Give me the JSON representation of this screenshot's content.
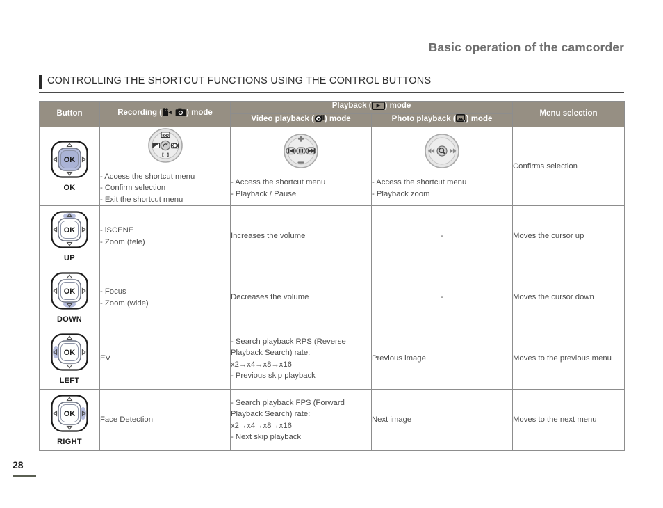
{
  "running_head": "Basic operation of the camcorder",
  "section_title": "CONTROLLING THE SHORTCUT FUNCTIONS USING THE CONTROL BUTTONS",
  "page_number": "28",
  "table": {
    "headers": {
      "button": "Button",
      "recording_pre": "Recording (",
      "recording_post": ") mode",
      "playback_pre": "Playback (",
      "playback_post": ") mode",
      "video_playback_pre": "Video playback (",
      "video_playback_post": ") mode",
      "photo_playback_pre": "Photo playback (",
      "photo_playback_post": ") mode",
      "menu_selection": "Menu selection"
    },
    "icons": {
      "recording_movie": "movie-camera-icon",
      "recording_photo": "still-camera-icon",
      "playback": "play-mode-icon",
      "video_playback": "video-playback-icon",
      "photo_playback": "photo-playback-icon"
    },
    "rows": [
      {
        "button_label": "OK",
        "dial": "ok-center",
        "recording": "- Access the shortcut menu\n- Confirm selection\n- Exit the shortcut menu",
        "recording_icon": "record-shortcut-dial-icon",
        "video_playback": "- Access the shortcut menu\n- Playback / Pause",
        "video_playback_icon": "video-shortcut-dial-icon",
        "photo_playback": "- Access the shortcut menu\n- Playback zoom",
        "photo_playback_icon": "photo-shortcut-dial-icon",
        "menu_selection": "Confirms selection"
      },
      {
        "button_label": "UP",
        "dial": "ok-up",
        "recording": "- iSCENE\n- Zoom (tele)",
        "video_playback": "Increases the volume",
        "photo_playback": "-",
        "menu_selection": "Moves the cursor up"
      },
      {
        "button_label": "DOWN",
        "dial": "ok-down",
        "recording": "- Focus\n- Zoom (wide)",
        "video_playback": "Decreases the volume",
        "photo_playback": "-",
        "menu_selection": "Moves the cursor down"
      },
      {
        "button_label": "LEFT",
        "dial": "ok-left",
        "recording": "EV",
        "video_playback": " - Search playback RPS (Reverse\n    Playback Search) rate:\n    x2→x4→x8→x16\n - Previous skip playback",
        "photo_playback": "Previous image",
        "menu_selection": "Moves to the previous menu"
      },
      {
        "button_label": "RIGHT",
        "dial": "ok-right",
        "recording": "Face Detection",
        "video_playback": " - Search playback FPS (Forward\n    Playback Search) rate:\n    x2→x4→x8→x16\n - Next skip playback",
        "photo_playback": "Next image",
        "menu_selection": "Moves to the next menu"
      }
    ]
  },
  "colors": {
    "header_bg": "#968f83",
    "rule": "#8d8d8d",
    "highlight": "#b6bede",
    "text": "#4d4d4d"
  }
}
